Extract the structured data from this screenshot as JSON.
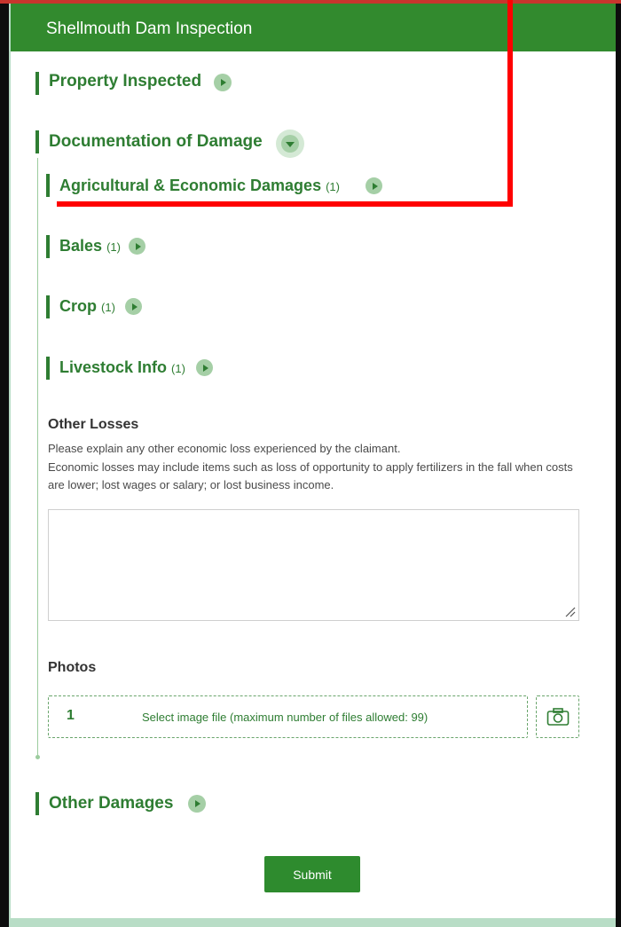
{
  "header": {
    "title": "Shellmouth Dam Inspection"
  },
  "groups": {
    "property": {
      "title": "Property Inspected"
    },
    "documentation": {
      "title": "Documentation of Damage"
    },
    "agricultural": {
      "title": "Agricultural & Economic Damages",
      "count": "(1)"
    },
    "bales": {
      "title": "Bales",
      "count": "(1)"
    },
    "crop": {
      "title": "Crop",
      "count": "(1)"
    },
    "livestock": {
      "title": "Livestock Info",
      "count": "(1)"
    },
    "other_damages": {
      "title": "Other Damages"
    }
  },
  "other_losses": {
    "label": "Other Losses",
    "hint_line1": "Please explain any other economic loss experienced by the claimant.",
    "hint_line2": "Economic losses may include items such as loss of opportunity to apply fertilizers in the fall when costs are lower; lost wages or salary; or lost business income.",
    "value": ""
  },
  "photos": {
    "label": "Photos",
    "count": "1",
    "select_text": "Select image file (maximum number of files allowed: 99)"
  },
  "submit_label": "Submit",
  "icons": {
    "expand": "chevron-right-icon",
    "collapse": "chevron-down-icon",
    "camera": "camera-icon",
    "resize": "resize-handle-icon"
  },
  "colors": {
    "header": "#328a2e",
    "accent": "#2e7d32",
    "toggle": "#a5cfa6",
    "annotation": "#ff0000"
  }
}
